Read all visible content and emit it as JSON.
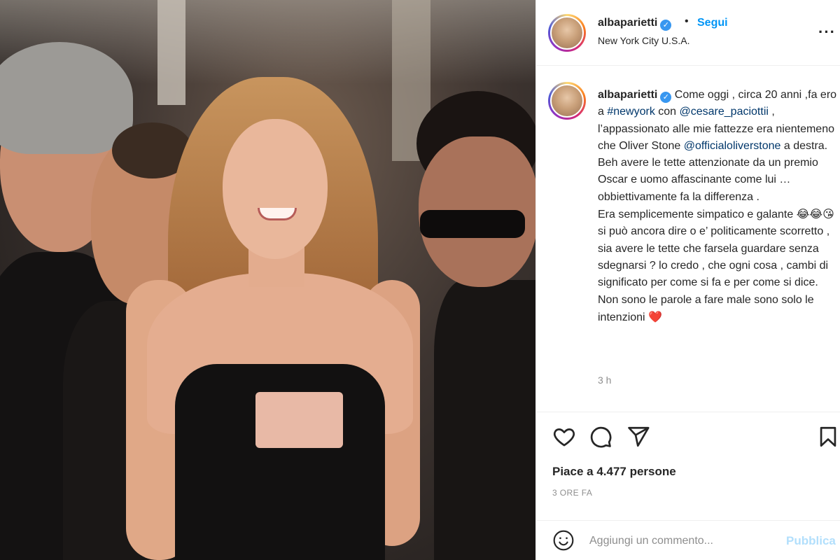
{
  "post": {
    "username": "albaparietti",
    "verified_icon": "verified-badge-icon",
    "dot": "•",
    "follow_label": "Segui",
    "location": "New York City U.S.A.",
    "more_icon": "more-options-icon"
  },
  "caption": {
    "username": "albaparietti",
    "segments": {
      "s1": " Come oggi , circa 20 anni ,fa ero a ",
      "hashtag": "#newyork",
      "s2": " con ",
      "mention1": "@cesare_paciottii",
      "s3": " , l’appassionato alle mie fattezze era nientemeno che Oliver Stone ",
      "mention2": "@officialoliverstone",
      "s4": " a destra.",
      "s5": "Beh avere le tette attenzionate da un premio Oscar e uomo affascinante come lui … obbiettivamente fa la differenza .",
      "s6": "Era semplicemente simpatico e galante ",
      "emojis": "😂😂😘",
      "s7": "si può ancora dire o e’ politicamente scorretto , sia avere le tette che farsela guardare senza sdegnarsi ? lo credo , che ogni cosa , cambi di significato per come si fa e per come si dice. Non sono le parole a fare male sono solo le intenzioni ",
      "heart": "❤️"
    },
    "time": "3 h"
  },
  "actions": {
    "like_icon": "heart-icon",
    "comment_icon": "comment-icon",
    "share_icon": "share-icon",
    "save_icon": "bookmark-icon",
    "likes_text": "Piace a 4.477 persone",
    "posted_ago": "3 ORE FA"
  },
  "comment_box": {
    "emoji_icon": "smiley-icon",
    "placeholder": "Aggiungi un commento...",
    "publish_label": "Pubblica"
  }
}
